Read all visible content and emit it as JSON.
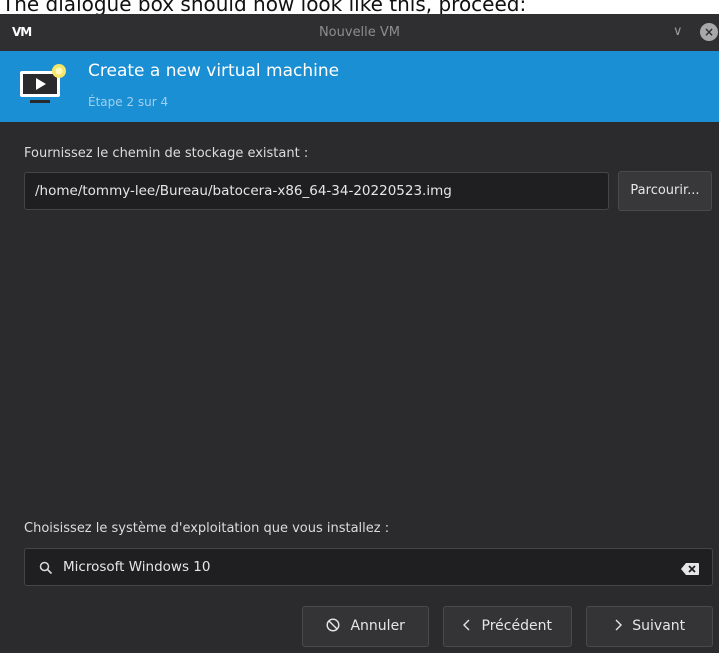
{
  "caption": "The dialogue box should now look like this, proceed:",
  "window": {
    "app_logo": "VM",
    "title": "Nouvelle VM",
    "controls": {
      "collapse_glyph": "∨",
      "close_glyph": "×"
    }
  },
  "banner": {
    "title": "Create a new virtual machine",
    "step": "Étape 2 sur 4",
    "icon": "monitor-new-icon",
    "color": "#1b8fd3"
  },
  "storage": {
    "label": "Fournissez le chemin de stockage existant :",
    "path_value": "/home/tommy-lee/Bureau/batocera-x86_64-34-20220523.img",
    "browse_label": "Parcourir..."
  },
  "os": {
    "label": "Choisissez le système d'exploitation que vous installez :",
    "search_value": "Microsoft Windows 10",
    "search_icon": "search-icon",
    "clear_icon": "clear-icon"
  },
  "footer": {
    "cancel_label": "Annuler",
    "back_label": "Précédent",
    "next_label": "Suivant"
  }
}
